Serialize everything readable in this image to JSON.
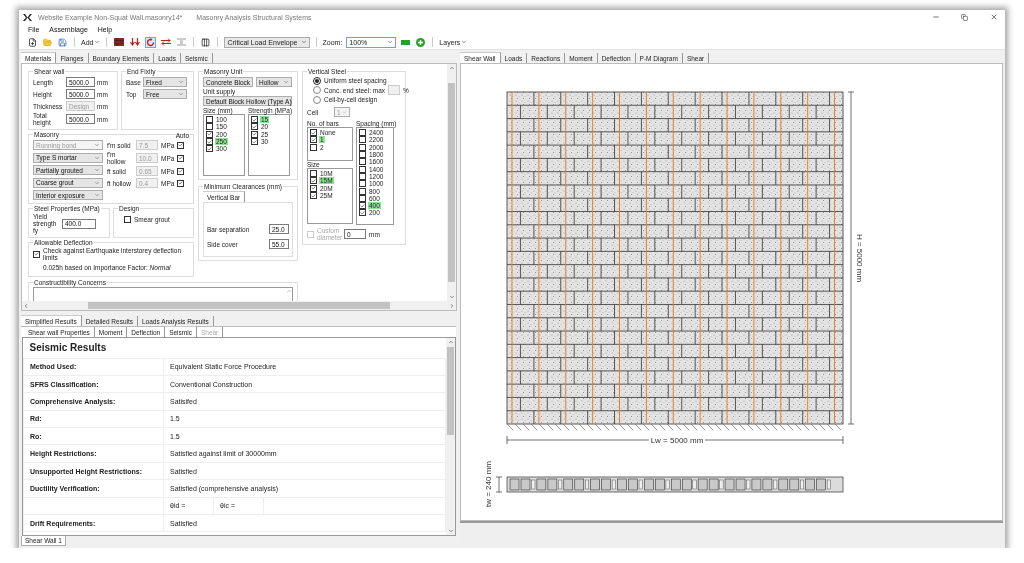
{
  "window": {
    "title": "Website Example Non-Squat Wall.masonry14*",
    "app_name": "Masonry Analysis Structural Systems"
  },
  "menu": [
    {
      "label": "File"
    },
    {
      "label": "Assemblage"
    },
    {
      "label": "Help"
    }
  ],
  "toolbar": {
    "add": "Add",
    "load_case": "Critical Load Envelope",
    "zoom_label": "Zoom:",
    "zoom": "100%",
    "layers": "Layers"
  },
  "input_tabs": [
    {
      "label": "Materials",
      "selected": true
    },
    {
      "label": "Flanges",
      "selected": false
    },
    {
      "label": "Boundary Elements",
      "selected": false
    },
    {
      "label": "Loads",
      "selected": false
    },
    {
      "label": "Seismic",
      "selected": false
    }
  ],
  "shear_wall": {
    "title": "Shear wall",
    "fields": [
      {
        "label": "Length",
        "value": "5000.0",
        "unit": "mm",
        "disabled": false
      },
      {
        "label": "Height",
        "value": "5000.0",
        "unit": "mm",
        "disabled": false
      },
      {
        "label": "Thickness",
        "value": "Design",
        "unit": "mm",
        "disabled": true
      },
      {
        "label": "Total height",
        "value": "5000.0",
        "unit": "mm",
        "disabled": false
      }
    ]
  },
  "end_fixity": {
    "title": "End Fixity",
    "rows": [
      {
        "label": "Base",
        "value": "Fixed"
      },
      {
        "label": "Top",
        "value": "Free"
      }
    ]
  },
  "masonry": {
    "title": "Masonry",
    "options": [
      {
        "value": "Running bond",
        "disabled": true
      },
      {
        "value": "Type S mortar",
        "disabled": false
      },
      {
        "value": "Partially grouted",
        "disabled": false
      },
      {
        "value": "Coarse grout",
        "disabled": false
      },
      {
        "value": "Interior exposure",
        "disabled": false
      }
    ],
    "auto_label": "Auto",
    "properties": [
      {
        "label": "f'm solid",
        "value": "7.5",
        "unit": "MPa",
        "auto": true
      },
      {
        "label": "f'm hollow",
        "value": "10.0",
        "unit": "MPa",
        "auto": true
      },
      {
        "label": "ft solid",
        "value": "0.65",
        "unit": "MPa",
        "auto": true
      },
      {
        "label": "ft hollow",
        "value": "0.4",
        "unit": "MPa",
        "auto": true
      }
    ]
  },
  "steel": {
    "title": "Steel Properties (MPa)",
    "label": "Yield strength fy",
    "value": "400.0"
  },
  "design": {
    "title": "Design",
    "label": "Smear grout",
    "checked": false
  },
  "deflection": {
    "title": "Allowable Deflection",
    "label": "Check against Earthquake interstorey deflection limits",
    "checked": true,
    "note": "0.025h based on Importance Factor: *Normal*"
  },
  "constructibility": {
    "title": "Constructibility Concerns"
  },
  "masonry_unit": {
    "title": "Masonry Unit",
    "type": "Concrete Block",
    "core": "Hollow",
    "supply_label": "Unit supply",
    "supply": "Default Block Hollow (Type A)",
    "sizes": {
      "title": "Size (mm)",
      "items": [
        {
          "label": "100",
          "checked": false,
          "selected": false
        },
        {
          "label": "150",
          "checked": false,
          "selected": false
        },
        {
          "label": "200",
          "checked": true,
          "selected": false
        },
        {
          "label": "250",
          "checked": true,
          "selected": true
        },
        {
          "label": "300",
          "checked": true,
          "selected": false
        }
      ]
    },
    "strengths": {
      "title": "Strength (MPa)",
      "items": [
        {
          "label": "15",
          "checked": true,
          "selected": true
        },
        {
          "label": "20",
          "checked": true,
          "selected": false
        },
        {
          "label": "25",
          "checked": true,
          "selected": false
        },
        {
          "label": "30",
          "checked": true,
          "selected": false
        }
      ]
    }
  },
  "clearances": {
    "title": "Minimum Clearances (mm)",
    "tabs": [
      {
        "label": "Vertical Bar",
        "selected": true
      }
    ],
    "fields": [
      {
        "label": "Bar separation",
        "value": "25.0"
      },
      {
        "label": "Side cover",
        "value": "55.0"
      }
    ]
  },
  "vertical_steel": {
    "title": "Vertical Steel",
    "options": [
      {
        "label": "Uniform steel spacing",
        "selected": true
      },
      {
        "label": "Conc. end steel: max",
        "selected": false
      },
      {
        "label": "Cell-by-cell design",
        "selected": false
      }
    ],
    "percent_unit": "%",
    "cell_label": "Cell",
    "cell_value": "1",
    "bars": {
      "title": "No. of bars",
      "items": [
        {
          "label": "None",
          "checked": true,
          "selected": false
        },
        {
          "label": "1",
          "checked": true,
          "selected": true
        },
        {
          "label": "2",
          "checked": false,
          "selected": false
        }
      ]
    },
    "sizes": {
      "title": "Size",
      "items": [
        {
          "label": "10M",
          "checked": false,
          "selected": false
        },
        {
          "label": "15M",
          "checked": true,
          "selected": true
        },
        {
          "label": "20M",
          "checked": true,
          "selected": false
        },
        {
          "label": "25M",
          "checked": true,
          "selected": false
        }
      ]
    },
    "spacing": {
      "title": "Spacing (mm)",
      "items": [
        {
          "label": "2400",
          "checked": false,
          "selected": false
        },
        {
          "label": "2200",
          "checked": false,
          "selected": false
        },
        {
          "label": "2000",
          "checked": false,
          "selected": false
        },
        {
          "label": "1800",
          "checked": false,
          "selected": false
        },
        {
          "label": "1600",
          "checked": false,
          "selected": false
        },
        {
          "label": "1400",
          "checked": false,
          "selected": false
        },
        {
          "label": "1200",
          "checked": false,
          "selected": false
        },
        {
          "label": "1000",
          "checked": false,
          "selected": false
        },
        {
          "label": "800",
          "checked": false,
          "selected": false
        },
        {
          "label": "600",
          "checked": false,
          "selected": false
        },
        {
          "label": "400",
          "checked": true,
          "selected": true
        },
        {
          "label": "200",
          "checked": true,
          "selected": false
        }
      ]
    },
    "custom": {
      "label": "Custom diameter",
      "checked": false,
      "disabled": true,
      "value": "0",
      "unit": "mm"
    }
  },
  "results_tabs": [
    {
      "label": "Simplified Results",
      "selected": true
    },
    {
      "label": "Detailed Results",
      "selected": false
    },
    {
      "label": "Loads Analysis Results",
      "selected": false
    }
  ],
  "result_subtabs": [
    {
      "label": "Shear wall Properties",
      "selected": false,
      "disabled": false
    },
    {
      "label": "Moment",
      "selected": false,
      "disabled": false
    },
    {
      "label": "Deflection",
      "selected": false,
      "disabled": false
    },
    {
      "label": "Seismic",
      "selected": true,
      "disabled": false
    },
    {
      "label": "Shear",
      "selected": false,
      "disabled": true
    }
  ],
  "results": {
    "title": "Seismic Results",
    "rows": [
      {
        "kind": "pair",
        "label": "Method Used:",
        "value": "Equivalent Static Force Procedure"
      },
      {
        "kind": "pair",
        "label": "SFRS Classification:",
        "value": "Conventional Construction"
      },
      {
        "kind": "pair",
        "label": "Comprehensive Analysis:",
        "value": "Satisifed"
      },
      {
        "kind": "pair",
        "label": "Rd:",
        "value": "1.5"
      },
      {
        "kind": "pair",
        "label": "Ro:",
        "value": "1.5"
      },
      {
        "kind": "pair",
        "label": "Height Restrictions:",
        "value": "Satisfied against limit of 30000mm"
      },
      {
        "kind": "pair",
        "label": "Unsupported Height Restrictions:",
        "value": "Satisfied"
      },
      {
        "kind": "pair",
        "label": "Ductility Verification:",
        "value": "Satisfied (comprehensive analysis)"
      },
      {
        "kind": "split",
        "cells": [
          "θid =",
          "θic ="
        ]
      },
      {
        "kind": "pair",
        "label": "Drift Requirements:",
        "value": "Satisfied"
      }
    ]
  },
  "doc_tabs": [
    {
      "label": "Shear Wall 1",
      "selected": true
    }
  ],
  "view_tabs": [
    {
      "label": "Shear Wall",
      "selected": true
    },
    {
      "label": "Loads",
      "selected": false
    },
    {
      "label": "Reactions",
      "selected": false
    },
    {
      "label": "Moment",
      "selected": false
    },
    {
      "label": "Deflection",
      "selected": false
    },
    {
      "label": "P-M Diagram",
      "selected": false
    },
    {
      "label": "Shear",
      "selected": false
    }
  ],
  "drawing": {
    "width_label": "Lw = 5000 mm",
    "height_label": "H = 5000 mm",
    "thickness_label": "tw = 240 mm"
  }
}
